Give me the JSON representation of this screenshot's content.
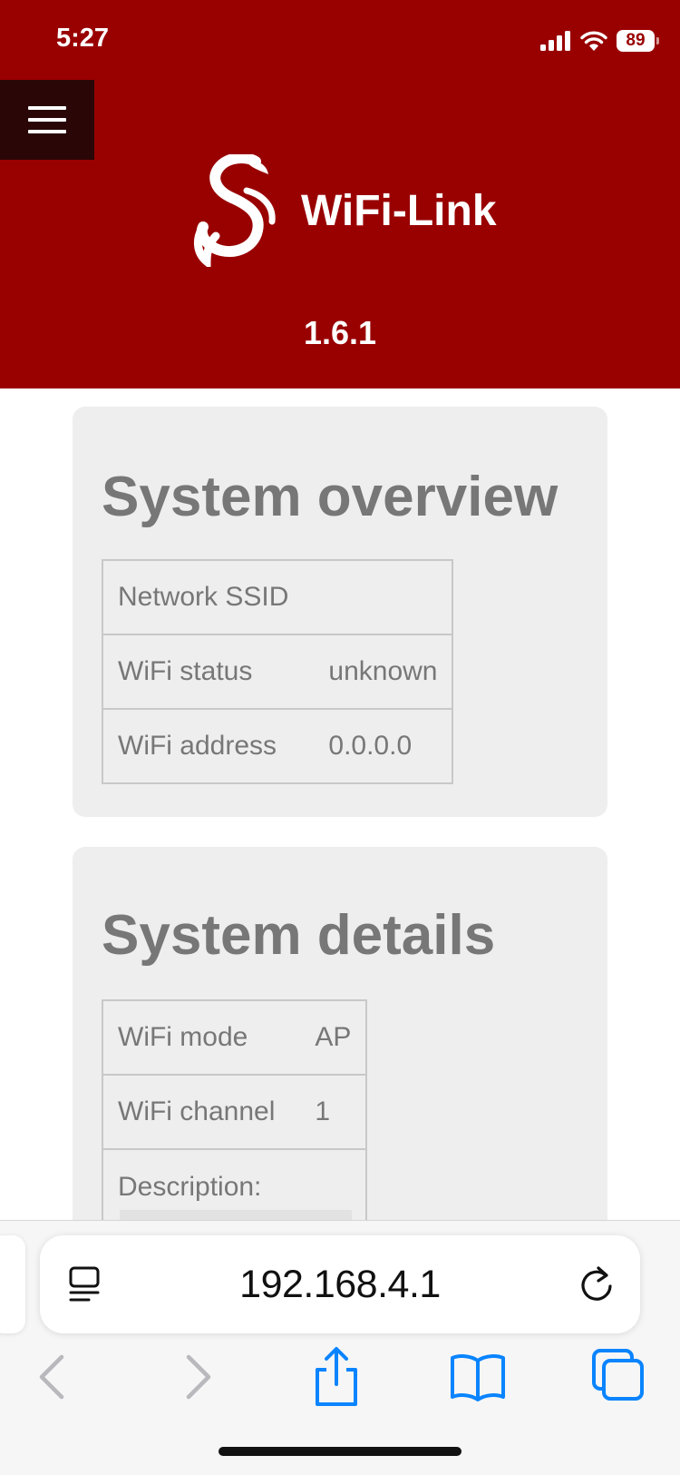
{
  "status_bar": {
    "time": "5:27",
    "battery": "89",
    "icons": [
      "signal-icon",
      "wifi-icon",
      "battery-icon"
    ]
  },
  "header": {
    "menu_icon": "hamburger-menu-icon",
    "logo_icon": "wifi-link-logo-icon",
    "title": "WiFi-Link",
    "version": "1.6.1",
    "background_color": "#990000"
  },
  "system_overview": {
    "title": "System overview",
    "rows": [
      {
        "label": "Network SSID",
        "value": ""
      },
      {
        "label": "WiFi status",
        "value": "unknown"
      },
      {
        "label": "WiFi address",
        "value": "0.0.0.0"
      }
    ]
  },
  "system_details": {
    "title": "System details",
    "rows": [
      {
        "label": "WiFi mode",
        "value": "AP"
      },
      {
        "label": "WiFi channel",
        "value": "1"
      }
    ],
    "description_label": "Description:"
  },
  "browser": {
    "url": "192.168.4.1",
    "icons": [
      "page-menu-icon",
      "reload-icon",
      "back-icon",
      "forward-icon",
      "share-icon",
      "bookmarks-icon",
      "tabs-icon"
    ],
    "accent_color": "#0a84ff"
  }
}
